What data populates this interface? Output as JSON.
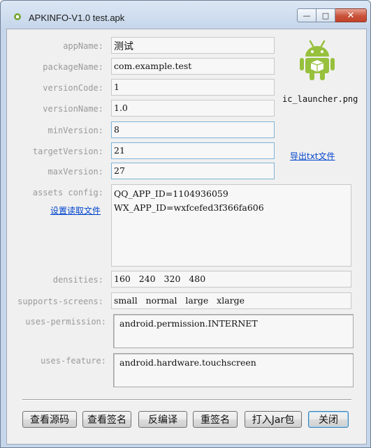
{
  "window": {
    "title": "APKINFO-V1.0  test.apk",
    "min_glyph": "—",
    "max_glyph": "□",
    "close_glyph": "✕"
  },
  "fields": {
    "appName": {
      "label": "appName:",
      "value": "测试"
    },
    "packageName": {
      "label": "packageName:",
      "value": "com.example.test"
    },
    "versionCode": {
      "label": "versionCode:",
      "value": "1"
    },
    "versionName": {
      "label": "versionName:",
      "value": "1.0"
    },
    "minVersion": {
      "label": "minVersion:",
      "value": "8"
    },
    "targetVersion": {
      "label": "targetVersion:",
      "value": "21"
    },
    "maxVersion": {
      "label": "maxVersion:",
      "value": "27"
    }
  },
  "icon_caption": "ic_launcher.png",
  "export_link": "导出txt文件",
  "assets": {
    "label": "assets config:",
    "link": "设置读取文件",
    "lines": [
      "QQ_APP_ID=1104936059",
      "WX_APP_ID=wxfcefed3f366fa606"
    ]
  },
  "densities": {
    "label": "densities:",
    "value": "160   240   320   480"
  },
  "supports_screens": {
    "label": "supports-screens:",
    "value": "small   normal   large   xlarge"
  },
  "uses_permission": {
    "label": "uses-permission:",
    "value": "android.permission.INTERNET"
  },
  "uses_feature": {
    "label": "uses-feature:",
    "value": "android.hardware.touchscreen"
  },
  "buttons": {
    "view_source": "查看源码",
    "view_signature": "查看签名",
    "decompile": "反编译",
    "resign": "重签名",
    "build_jar": "打入Jar包",
    "close": "关闭"
  },
  "colors": {
    "android_green": "#97c03d",
    "link_blue": "#0044cc",
    "label_gray": "#9a9a9a"
  }
}
